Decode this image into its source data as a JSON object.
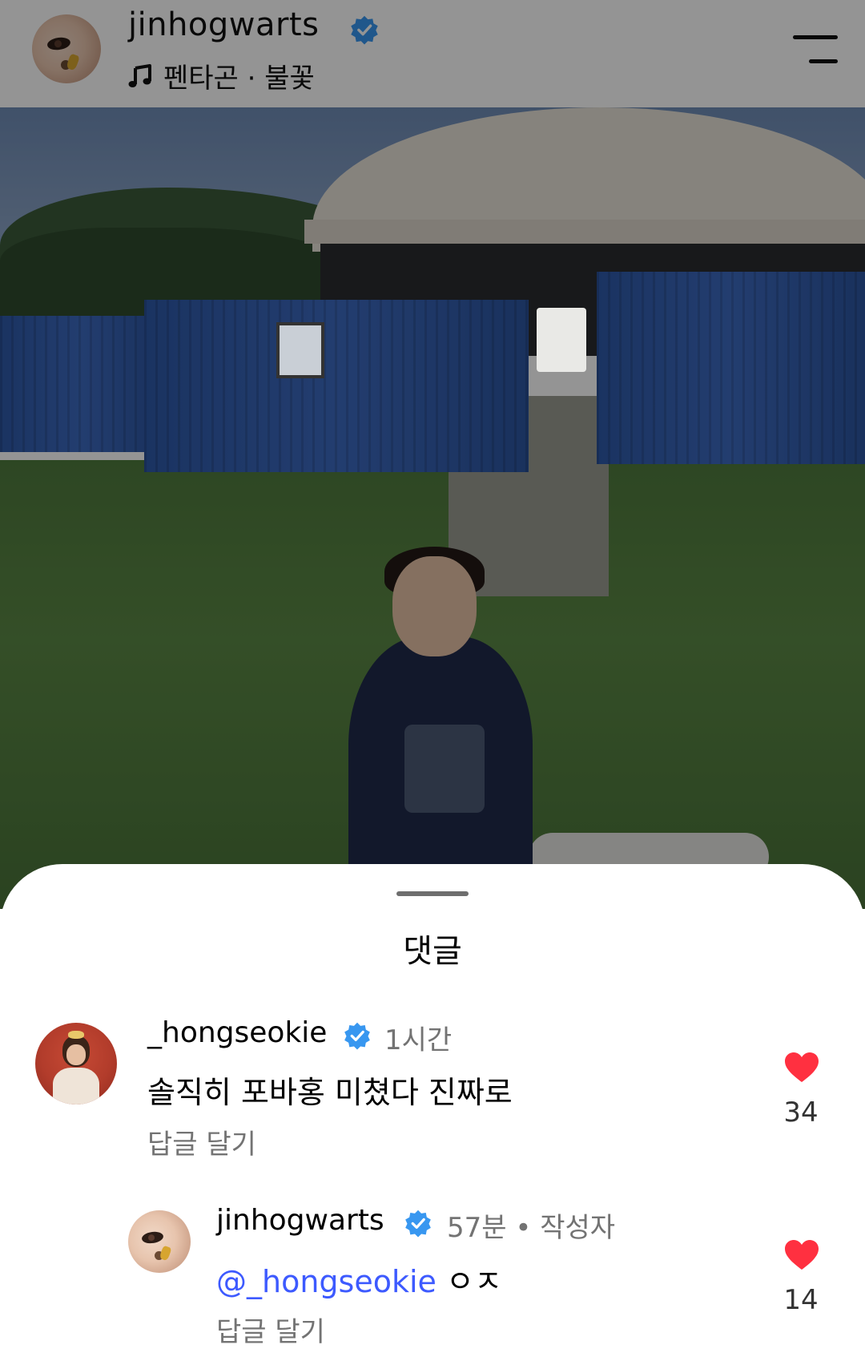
{
  "header": {
    "username": "jinhogwarts",
    "music": "펜타곤 · 불꽃",
    "avatar_icon": "profile-photo",
    "verified_icon": "verified-badge-icon",
    "music_icon": "music-note-icon",
    "menu_icon": "hamburger-menu-icon"
  },
  "sheet": {
    "title": "댓글"
  },
  "comments": [
    {
      "username": "_hongseokie",
      "time": "1시간",
      "text": "솔직히 포바홍 미쳤다 진짜로",
      "reply_label": "답글 달기",
      "likes": "34"
    },
    {
      "username": "jinhogwarts",
      "time": "57분",
      "author_tag": "작성자",
      "mention": "@_hongseokie",
      "text": "ㅇㅈ",
      "reply_label": "답글 달기",
      "likes": "14"
    }
  ],
  "colors": {
    "verified": "#3897f0",
    "heart": "#ff3040",
    "mention": "#3d5aff",
    "muted": "#737373"
  }
}
